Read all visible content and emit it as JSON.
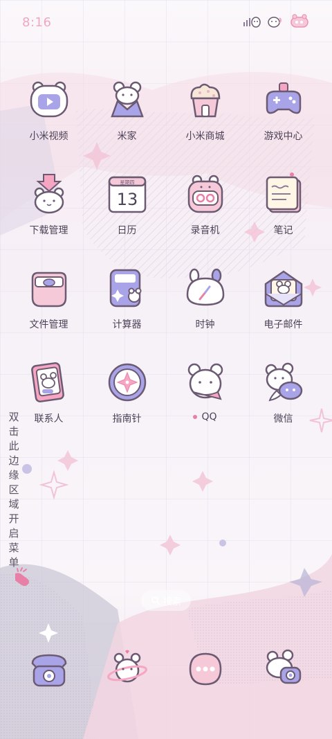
{
  "status_bar": {
    "time": "8:16",
    "icons": [
      "signal-icon",
      "wifi-icon",
      "battery-icon"
    ]
  },
  "apps": [
    {
      "label": "小米视频",
      "icon": "video-icon"
    },
    {
      "label": "米家",
      "icon": "mijia-icon"
    },
    {
      "label": "小米商城",
      "icon": "shop-icon"
    },
    {
      "label": "游戏中心",
      "icon": "gamepad-icon"
    },
    {
      "label": "下载管理",
      "icon": "download-icon"
    },
    {
      "label": "日历",
      "icon": "calendar-icon",
      "calendar_weekday": "星期四",
      "calendar_day": "13"
    },
    {
      "label": "录音机",
      "icon": "recorder-icon"
    },
    {
      "label": "笔记",
      "icon": "notes-icon"
    },
    {
      "label": "文件管理",
      "icon": "folder-icon"
    },
    {
      "label": "计算器",
      "icon": "calculator-icon"
    },
    {
      "label": "时钟",
      "icon": "clock-icon"
    },
    {
      "label": "电子邮件",
      "icon": "mail-icon"
    },
    {
      "label": "联系人",
      "icon": "contacts-icon"
    },
    {
      "label": "指南针",
      "icon": "compass-icon"
    },
    {
      "label": "QQ",
      "icon": "qq-icon",
      "has_notification": true
    },
    {
      "label": "微信",
      "icon": "wechat-icon"
    }
  ],
  "edge_hint": "双击此边缘区域开启菜单",
  "search": {
    "label": "搜索"
  },
  "dock": [
    {
      "icon": "phone-icon"
    },
    {
      "icon": "browser-icon"
    },
    {
      "icon": "messages-icon"
    },
    {
      "icon": "camera-icon"
    }
  ],
  "colors": {
    "accent_pink": "#f0a7bf",
    "lavender": "#a9a4e8",
    "text": "#4d4358",
    "outline": "#6b5a72"
  }
}
